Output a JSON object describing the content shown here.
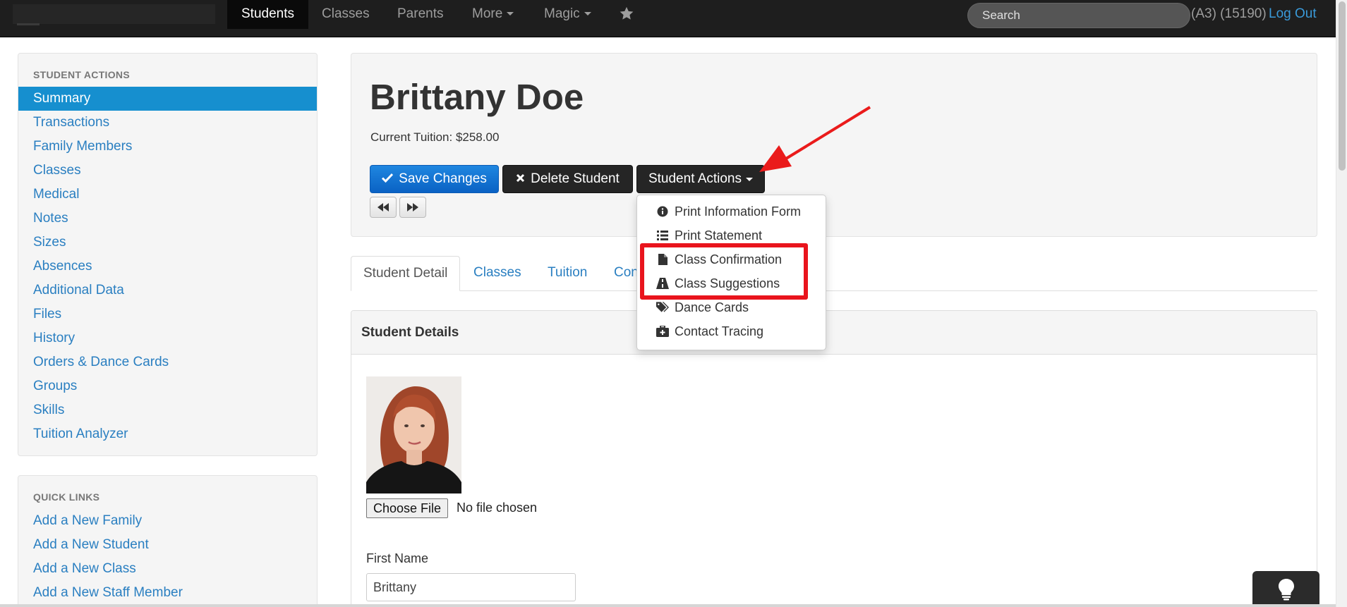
{
  "navbar": {
    "items": [
      {
        "label": "Students",
        "active": true
      },
      {
        "label": "Classes"
      },
      {
        "label": "Parents"
      },
      {
        "label": "More"
      },
      {
        "label": "Magic"
      }
    ],
    "search_placeholder": "Search",
    "user_code": "(A3) (15190)",
    "logout_label": "Log Out"
  },
  "sidebar": {
    "heading": "STUDENT ACTIONS",
    "items": [
      {
        "label": "Summary",
        "active": true
      },
      {
        "label": "Transactions"
      },
      {
        "label": "Family Members"
      },
      {
        "label": "Classes"
      },
      {
        "label": "Medical"
      },
      {
        "label": "Notes"
      },
      {
        "label": "Sizes"
      },
      {
        "label": "Absences"
      },
      {
        "label": "Additional Data"
      },
      {
        "label": "Files"
      },
      {
        "label": "History"
      },
      {
        "label": "Orders & Dance Cards"
      },
      {
        "label": "Groups"
      },
      {
        "label": "Skills"
      },
      {
        "label": "Tuition Analyzer"
      }
    ]
  },
  "quick_links": {
    "heading": "QUICK LINKS",
    "items": [
      {
        "label": "Add a New Family"
      },
      {
        "label": "Add a New Student"
      },
      {
        "label": "Add a New Class"
      },
      {
        "label": "Add a New Staff Member"
      }
    ]
  },
  "student": {
    "name": "Brittany Doe",
    "tuition_text": "Current Tuition: $258.00"
  },
  "actions": {
    "save_label": "Save Changes",
    "delete_label": "Delete Student",
    "student_actions_label": "Student Actions",
    "menu": [
      {
        "label": "Print Information Form",
        "icon": "info-circle-icon"
      },
      {
        "label": "Print Statement",
        "icon": "list-icon"
      },
      {
        "label": "Class Confirmation",
        "icon": "file-icon"
      },
      {
        "label": "Class Suggestions",
        "icon": "road-icon"
      },
      {
        "label": "Dance Cards",
        "icon": "tags-icon"
      },
      {
        "label": "Contact Tracing",
        "icon": "medkit-icon"
      }
    ]
  },
  "tabs": [
    {
      "label": "Student Detail",
      "active": true
    },
    {
      "label": "Classes"
    },
    {
      "label": "Tuition"
    },
    {
      "label": "Con"
    }
  ],
  "details": {
    "title": "Student Details",
    "choose_file_label": "Choose File",
    "file_status": "No file chosen",
    "first_name_label": "First Name",
    "first_name_value": "Brittany"
  },
  "colors": {
    "accent": "#168fcf",
    "primary_button": "#0a62c4",
    "highlight": "#e9141d"
  }
}
